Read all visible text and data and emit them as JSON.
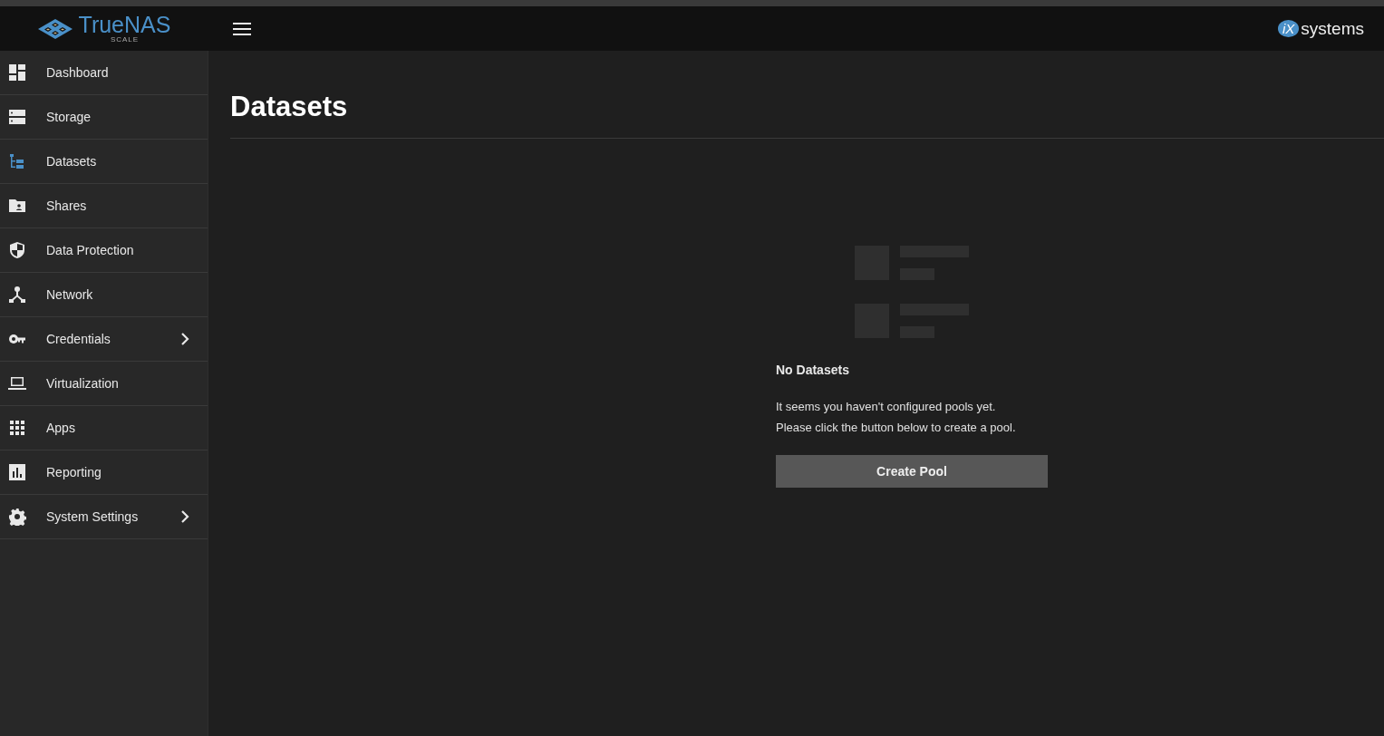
{
  "header": {
    "logo": {
      "name": "TrueNAS",
      "edition": "SCALE"
    },
    "vendor": {
      "mark": "iX",
      "name": "systems"
    }
  },
  "sidebar": {
    "items": [
      {
        "label": "Dashboard",
        "selected": false,
        "has_submenu": false
      },
      {
        "label": "Storage",
        "selected": false,
        "has_submenu": false
      },
      {
        "label": "Datasets",
        "selected": true,
        "has_submenu": false
      },
      {
        "label": "Shares",
        "selected": false,
        "has_submenu": false
      },
      {
        "label": "Data Protection",
        "selected": false,
        "has_submenu": false
      },
      {
        "label": "Network",
        "selected": false,
        "has_submenu": false
      },
      {
        "label": "Credentials",
        "selected": false,
        "has_submenu": true
      },
      {
        "label": "Virtualization",
        "selected": false,
        "has_submenu": false
      },
      {
        "label": "Apps",
        "selected": false,
        "has_submenu": false
      },
      {
        "label": "Reporting",
        "selected": false,
        "has_submenu": false
      },
      {
        "label": "System Settings",
        "selected": false,
        "has_submenu": true
      }
    ]
  },
  "page": {
    "title": "Datasets",
    "empty_state": {
      "title": "No Datasets",
      "message_lines": [
        "It seems you haven't configured pools yet.",
        "Please click the button below to create a pool."
      ],
      "button": "Create Pool"
    }
  }
}
